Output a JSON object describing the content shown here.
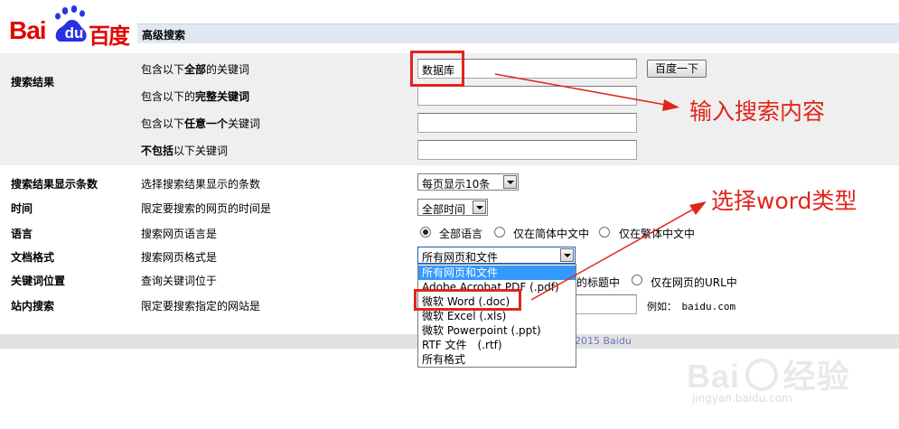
{
  "header": {
    "logo_text_latin": "Bai",
    "logo_text_du": "du",
    "logo_text_cn": "百度",
    "page_title": "高级搜索"
  },
  "search_results": {
    "section_label": "搜索结果",
    "rows": [
      {
        "prefix": "包含以下",
        "bold": "全部",
        "suffix": "的关键词",
        "value": "数据库"
      },
      {
        "prefix": "包含以下的",
        "bold": "完整关键词",
        "suffix": "",
        "value": ""
      },
      {
        "prefix": "包含以下",
        "bold": "任意一个",
        "suffix": "关键词",
        "value": ""
      },
      {
        "prefix": "",
        "bold": "不包括",
        "suffix": "以下关键词",
        "value": ""
      }
    ],
    "search_button": "百度一下"
  },
  "options": {
    "count": {
      "label": "搜索结果显示条数",
      "desc": "选择搜索结果显示的条数",
      "selected": "每页显示10条"
    },
    "time": {
      "label": "时间",
      "desc": "限定要搜索的网页的时间是",
      "selected": "全部时间"
    },
    "language": {
      "label": "语言",
      "desc": "搜索网页语言是",
      "radios": [
        "全部语言",
        "仅在简体中文中",
        "仅在繁体中文中"
      ],
      "selected_index": 0
    },
    "format": {
      "label": "文档格式",
      "desc": "搜索网页格式是",
      "selected": "所有网页和文件",
      "options": [
        "所有网页和文件",
        "Adobe Acrobat PDF (.pdf)",
        "微软 Word (.doc)",
        "微软 Excel (.xls)",
        "微软 Powerpoint (.ppt)",
        "RTF 文件　(.rtf)",
        "所有格式"
      ],
      "highlighted_index": 0
    },
    "keyword_position": {
      "label": "关键词位置",
      "desc": "查询关键词位于",
      "radio_visible_1": "的标题中",
      "radio_visible_2": "仅在网页的URL中"
    },
    "site": {
      "label": "站内搜索",
      "desc": "限定要搜索指定的网站是",
      "example": "例如：　baidu.com"
    }
  },
  "footer": {
    "copyright_visible": "2015 Baidu"
  },
  "annotations": {
    "input_note": "输入搜索内容",
    "format_note": "选择word类型",
    "color": "#e1251b"
  },
  "watermark": {
    "brand_latin": "Bai",
    "brand_cn": "经验",
    "url": "jingyan.baidu.com"
  }
}
